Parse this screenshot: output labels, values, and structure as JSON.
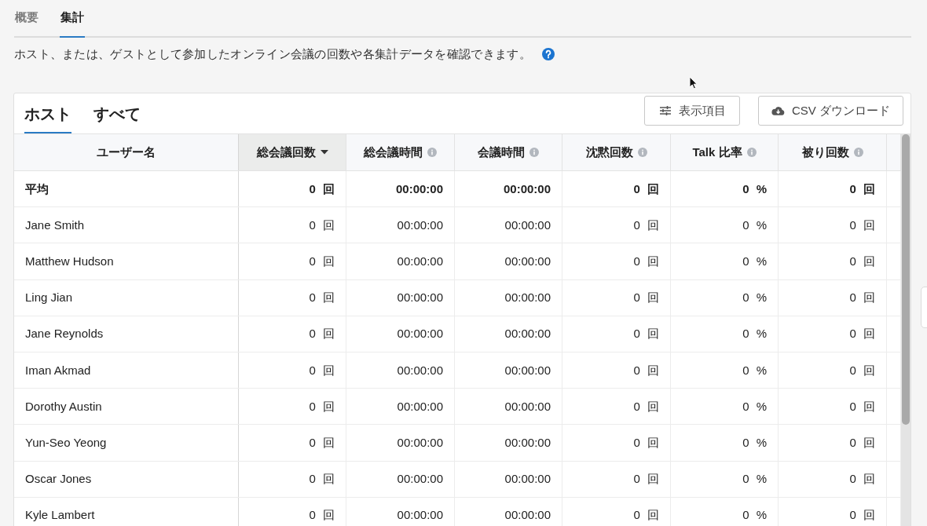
{
  "tabs": [
    {
      "label": "概要",
      "selected": false
    },
    {
      "label": "集計",
      "selected": true
    }
  ],
  "description": "ホスト、または、ゲストとして参加したオンライン会議の回数や各集計データを確認できます。",
  "panel": {
    "tabs": [
      {
        "label": "ホスト",
        "selected": true
      },
      {
        "label": "すべて",
        "selected": false
      }
    ],
    "buttons": [
      {
        "label": "表示項目",
        "kind": "columns"
      },
      {
        "label": "CSV ダウンロード",
        "kind": "download"
      }
    ]
  },
  "table": {
    "columns": [
      {
        "label": "ユーザー名",
        "sorted": false,
        "has_info": false
      },
      {
        "label": "総会議回数",
        "sorted": true,
        "has_info": false
      },
      {
        "label": "総会議時間",
        "sorted": false,
        "has_info": true
      },
      {
        "label": "会議時間",
        "sorted": false,
        "has_info": true
      },
      {
        "label": "沈黙回数",
        "sorted": false,
        "has_info": true
      },
      {
        "label": "Talk 比率",
        "sorted": false,
        "has_info": true
      },
      {
        "label": "被り回数",
        "sorted": false,
        "has_info": true
      }
    ],
    "rows": [
      {
        "kind": "summary",
        "cells": [
          "平均",
          "0 回",
          "00:00:00",
          "00:00:00",
          "0 回",
          "0 %",
          "0 回"
        ]
      },
      {
        "kind": "user",
        "cells": [
          "Jane Smith",
          "0 回",
          "00:00:00",
          "00:00:00",
          "0 回",
          "0 %",
          "0 回"
        ]
      },
      {
        "kind": "user",
        "cells": [
          "Matthew Hudson",
          "0 回",
          "00:00:00",
          "00:00:00",
          "0 回",
          "0 %",
          "0 回"
        ]
      },
      {
        "kind": "user",
        "cells": [
          "Ling Jian",
          "0 回",
          "00:00:00",
          "00:00:00",
          "0 回",
          "0 %",
          "0 回"
        ]
      },
      {
        "kind": "user",
        "cells": [
          "Jane Reynolds",
          "0 回",
          "00:00:00",
          "00:00:00",
          "0 回",
          "0 %",
          "0 回"
        ]
      },
      {
        "kind": "user",
        "cells": [
          "Iman Akmad",
          "0 回",
          "00:00:00",
          "00:00:00",
          "0 回",
          "0 %",
          "0 回"
        ]
      },
      {
        "kind": "user",
        "cells": [
          "Dorothy Austin",
          "0 回",
          "00:00:00",
          "00:00:00",
          "0 回",
          "0 %",
          "0 回"
        ]
      },
      {
        "kind": "user",
        "cells": [
          "Yun-Seo Yeong",
          "0 回",
          "00:00:00",
          "00:00:00",
          "0 回",
          "0 %",
          "0 回"
        ]
      },
      {
        "kind": "user",
        "cells": [
          "Oscar Jones",
          "0 回",
          "00:00:00",
          "00:00:00",
          "0 回",
          "0 %",
          "0 回"
        ]
      },
      {
        "kind": "user",
        "cells": [
          "Kyle Lambert",
          "0 回",
          "00:00:00",
          "00:00:00",
          "0 回",
          "0 %",
          "0 回"
        ]
      }
    ]
  }
}
